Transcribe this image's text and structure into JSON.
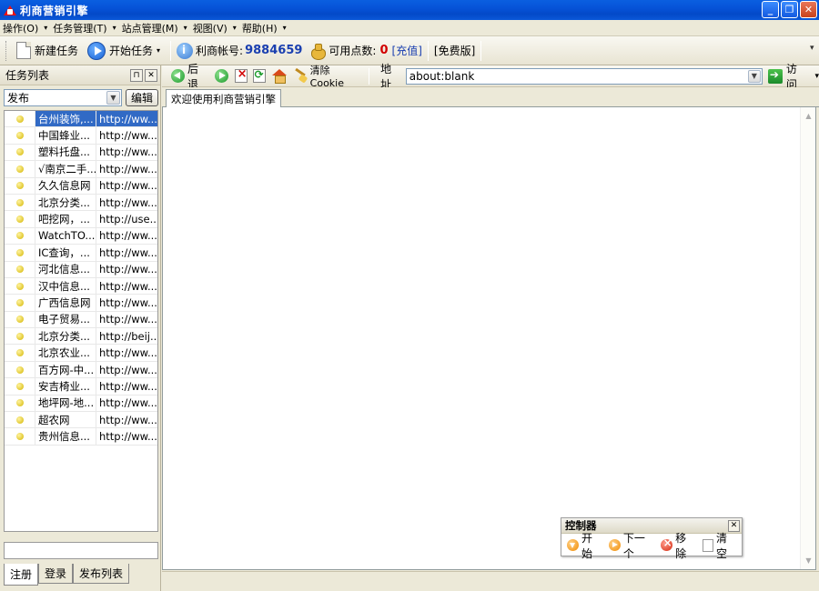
{
  "window": {
    "title": "利商营销引擎"
  },
  "menu": [
    {
      "label": "操作(O)"
    },
    {
      "label": "任务管理(T)"
    },
    {
      "label": "站点管理(M)"
    },
    {
      "label": "视图(V)"
    },
    {
      "label": "帮助(H)"
    }
  ],
  "toolbar": {
    "new_task": "新建任务",
    "start_task": "开始任务",
    "account_label": "利商帐号:",
    "account_number": "9884659",
    "points_label": "可用点数:",
    "points_value": "0",
    "recharge": "[充值]",
    "edition": "[免费版]"
  },
  "task_panel": {
    "title": "任务列表",
    "filter_value": "发布",
    "edit_button": "编辑",
    "rows": [
      {
        "name": "台州装饰,...",
        "url": "http://ww..."
      },
      {
        "name": "中国蜂业...",
        "url": "http://ww..."
      },
      {
        "name": "塑料托盘...",
        "url": "http://ww..."
      },
      {
        "name": "√南京二手...",
        "url": "http://ww..."
      },
      {
        "name": "久久信息网",
        "url": "http://ww..."
      },
      {
        "name": "北京分类...",
        "url": "http://ww..."
      },
      {
        "name": "吧挖网，...",
        "url": "http://use..."
      },
      {
        "name": "WatchTO...",
        "url": "http://ww..."
      },
      {
        "name": "IC查询，...",
        "url": "http://ww..."
      },
      {
        "name": "河北信息...",
        "url": "http://ww..."
      },
      {
        "name": "汉中信息...",
        "url": "http://ww..."
      },
      {
        "name": "广西信息网",
        "url": "http://ww..."
      },
      {
        "name": "电子贸易...",
        "url": "http://ww..."
      },
      {
        "name": "北京分类...",
        "url": "http://beij..."
      },
      {
        "name": "北京农业...",
        "url": "http://ww..."
      },
      {
        "name": "百方网-中...",
        "url": "http://ww..."
      },
      {
        "name": "安吉椅业...",
        "url": "http://ww..."
      },
      {
        "name": "地坪网-地...",
        "url": "http://ww..."
      },
      {
        "name": "超农网",
        "url": "http://ww..."
      },
      {
        "name": "贵州信息...",
        "url": "http://ww..."
      }
    ],
    "tabs": [
      "注册",
      "登录",
      "发布列表"
    ]
  },
  "browser": {
    "back": "后退",
    "clear_cookie": "清除Cookie",
    "address_label": "地址",
    "address_value": "about:blank",
    "go": "访问",
    "tab_title": "欢迎使用利商营销引擎"
  },
  "controller": {
    "title": "控制器",
    "start": "开始",
    "next": "下一个",
    "remove": "移除",
    "clear": "清空"
  }
}
